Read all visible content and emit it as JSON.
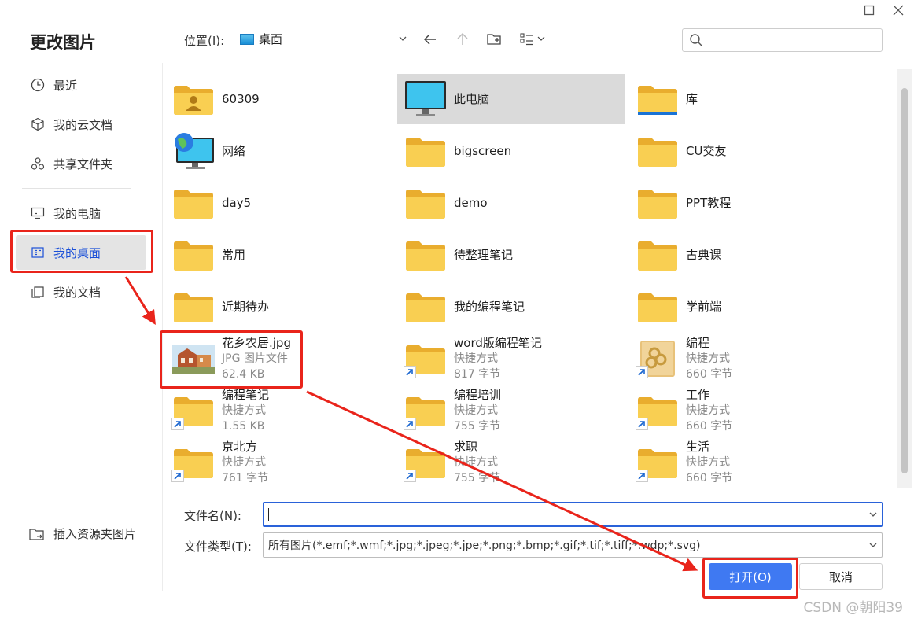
{
  "dialog": {
    "title": "更改图片"
  },
  "sidebar": {
    "items": [
      {
        "label": "最近",
        "icon": "clock-icon"
      },
      {
        "label": "我的云文档",
        "icon": "cube-icon"
      },
      {
        "label": "共享文件夹",
        "icon": "share-icon"
      },
      {
        "label": "我的电脑",
        "icon": "monitor-icon"
      },
      {
        "label": "我的桌面",
        "icon": "desktop-icon",
        "active": true
      },
      {
        "label": "我的文档",
        "icon": "documents-icon"
      }
    ],
    "insert_label": "插入资源夹图片"
  },
  "toolbar": {
    "location_label": "位置(I):",
    "location_value": "桌面"
  },
  "files": [
    {
      "name": "60309",
      "type": "user-folder"
    },
    {
      "name": "此电脑",
      "type": "computer",
      "selected": true
    },
    {
      "name": "库",
      "type": "library"
    },
    {
      "name": "网络",
      "type": "network"
    },
    {
      "name": "bigscreen",
      "type": "folder"
    },
    {
      "name": "CU交友",
      "type": "folder"
    },
    {
      "name": "day5",
      "type": "folder"
    },
    {
      "name": "demo",
      "type": "folder"
    },
    {
      "name": "PPT教程",
      "type": "folder"
    },
    {
      "name": "常用",
      "type": "folder"
    },
    {
      "name": "待整理笔记",
      "type": "folder"
    },
    {
      "name": "古典课",
      "type": "folder"
    },
    {
      "name": "近期待办",
      "type": "folder"
    },
    {
      "name": "我的编程笔记",
      "type": "folder"
    },
    {
      "name": "学前端",
      "type": "folder"
    },
    {
      "name": "花乡农居.jpg",
      "type": "image",
      "sub1": "JPG 图片文件",
      "sub2": "62.4 KB"
    },
    {
      "name": "word版编程笔记",
      "type": "shortcut-folder",
      "sub1": "快捷方式",
      "sub2": "817 字节"
    },
    {
      "name": "编程",
      "type": "shortcut-app",
      "sub1": "快捷方式",
      "sub2": "660 字节"
    },
    {
      "name": "编程笔记",
      "type": "shortcut-folder",
      "sub1": "快捷方式",
      "sub2": "1.55 KB"
    },
    {
      "name": "编程培训",
      "type": "shortcut-folder",
      "sub1": "快捷方式",
      "sub2": "755 字节"
    },
    {
      "name": "工作",
      "type": "shortcut-folder",
      "sub1": "快捷方式",
      "sub2": "660 字节"
    },
    {
      "name": "京北方",
      "type": "shortcut-folder",
      "sub1": "快捷方式",
      "sub2": "761 字节"
    },
    {
      "name": "求职",
      "type": "shortcut-folder",
      "sub1": "快捷方式",
      "sub2": "755 字节"
    },
    {
      "name": "生活",
      "type": "shortcut-folder",
      "sub1": "快捷方式",
      "sub2": "660 字节"
    }
  ],
  "bottom": {
    "filename_label": "文件名(N):",
    "filename_value": "",
    "filetype_label": "文件类型(T):",
    "filetype_value": "所有图片(*.emf;*.wmf;*.jpg;*.jpeg;*.jpe;*.png;*.bmp;*.gif;*.tif;*.tiff;*.wdp;*.svg)",
    "open_label": "打开(O)",
    "cancel_label": "取消"
  },
  "watermark": "CSDN @朝阳39",
  "colors": {
    "accent": "#3f79f2",
    "annotation": "#e9241b",
    "folder": "#f7c544"
  }
}
